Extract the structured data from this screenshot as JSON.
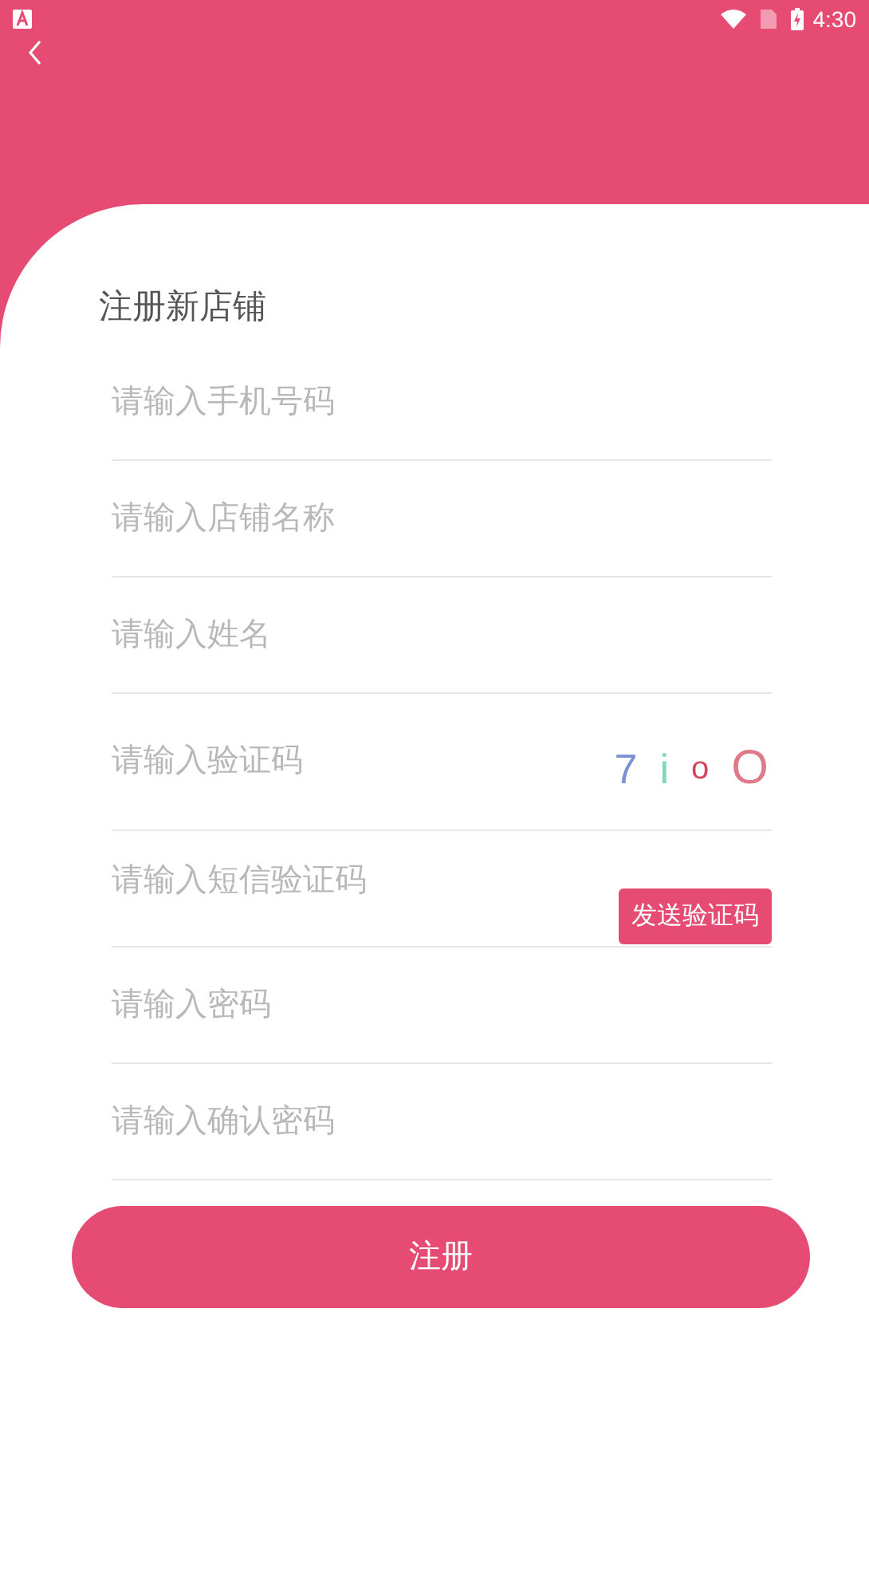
{
  "status_bar": {
    "time": "4:30"
  },
  "title": "注册新店铺",
  "fields": [
    {
      "kind": "text",
      "placeholder": "请输入手机号码"
    },
    {
      "kind": "text",
      "placeholder": "请输入店铺名称"
    },
    {
      "kind": "text",
      "placeholder": "请输入姓名"
    },
    {
      "kind": "captcha",
      "placeholder": "请输入验证码",
      "captcha": [
        {
          "char": "7",
          "color": "#7b8fd6"
        },
        {
          "char": "i",
          "color": "#7fd6b8"
        },
        {
          "char": "o",
          "color": "#d6455e"
        },
        {
          "char": "O",
          "color": "#e07a88"
        }
      ]
    },
    {
      "kind": "sms",
      "placeholder": "请输入短信验证码",
      "button": "发送验证码"
    },
    {
      "kind": "text",
      "placeholder": "请输入密码"
    },
    {
      "kind": "text",
      "placeholder": "请输入确认密码"
    }
  ],
  "submit": "注册"
}
